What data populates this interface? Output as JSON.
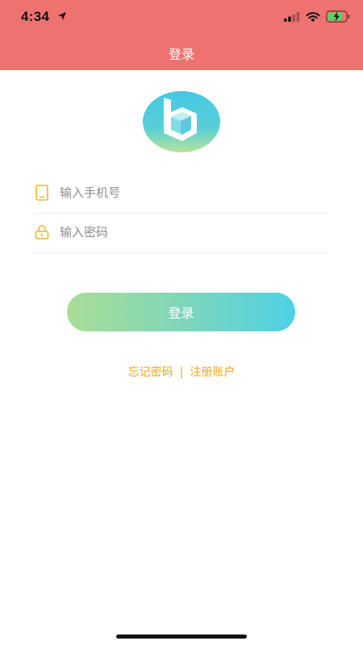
{
  "status_bar": {
    "time": "4:34"
  },
  "header": {
    "title": "登录"
  },
  "form": {
    "phone_placeholder": "输入手机号",
    "password_placeholder": "输入密码"
  },
  "actions": {
    "login_label": "登录",
    "forgot_password_label": "忘记密码",
    "separator": "|",
    "register_label": "注册账户"
  },
  "colors": {
    "header_bg": "#ee7370",
    "link_color": "#f1a51a",
    "button_gradient_start": "#a9dd96",
    "button_gradient_end": "#4dd1e6",
    "icon_color": "#f1b338"
  },
  "icons": {
    "location": "location-arrow-icon",
    "signal": "cellular-signal-icon",
    "wifi": "wifi-icon",
    "battery": "battery-charging-icon",
    "phone": "phone-icon",
    "lock": "lock-icon",
    "logo": "app-logo-b"
  }
}
